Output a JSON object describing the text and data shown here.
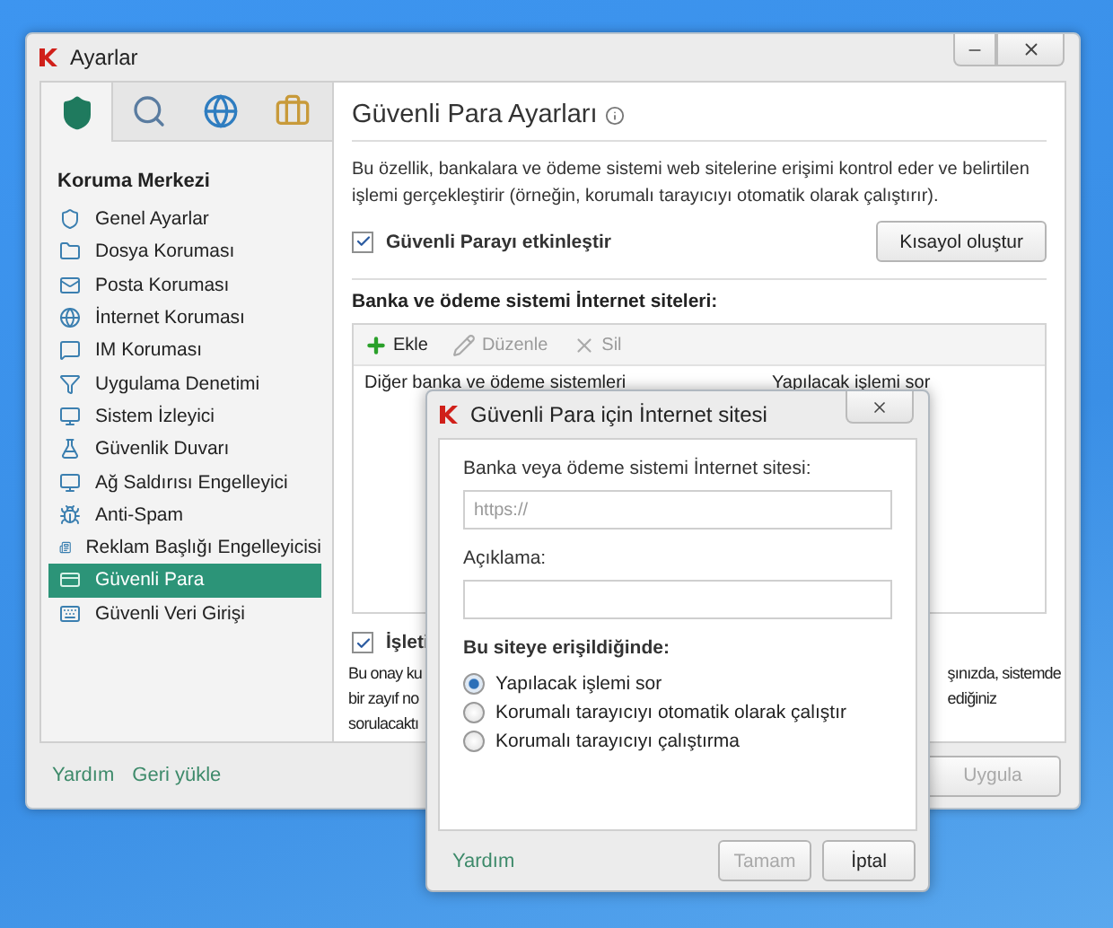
{
  "window": {
    "title": "Ayarlar"
  },
  "tabs": [
    {
      "selected": true
    },
    {
      "selected": false
    },
    {
      "selected": false
    },
    {
      "selected": false
    }
  ],
  "sidebar": {
    "heading": "Koruma Merkezi",
    "items": [
      {
        "label": "Genel Ayarlar",
        "selected": false
      },
      {
        "label": "Dosya Koruması",
        "selected": false
      },
      {
        "label": "Posta Koruması",
        "selected": false
      },
      {
        "label": "İnternet Koruması",
        "selected": false
      },
      {
        "label": "IM Koruması",
        "selected": false
      },
      {
        "label": "Uygulama Denetimi",
        "selected": false
      },
      {
        "label": "Sistem İzleyici",
        "selected": false
      },
      {
        "label": "Güvenlik Duvarı",
        "selected": false
      },
      {
        "label": "Ağ Saldırısı Engelleyici",
        "selected": false
      },
      {
        "label": "Anti-Spam",
        "selected": false
      },
      {
        "label": "Reklam Başlığı Engelleyicisi",
        "selected": false
      },
      {
        "label": "Güvenli Para",
        "selected": true
      },
      {
        "label": "Güvenli Veri Girişi",
        "selected": false
      }
    ]
  },
  "panel": {
    "title": "Güvenli Para Ayarları",
    "description": "Bu özellik, bankalara ve ödeme sistemi web sitelerine erişimi kontrol eder ve belirtilen işlemi gerçekleştirir (örneğin, korumalı tarayıcıyı otomatik olarak çalıştırır).",
    "enable": {
      "label": "Güvenli Parayı etkinleştir",
      "checked": true
    },
    "shortcut_button": "Kısayol oluştur",
    "sites_heading": "Banka ve ödeme sistemi İnternet siteleri:",
    "toolbar": [
      {
        "kind": "add",
        "label": "Ekle",
        "disabled": false
      },
      {
        "kind": "edit",
        "label": "Düzenle",
        "disabled": true
      },
      {
        "kind": "delete",
        "label": "Sil",
        "disabled": true
      }
    ],
    "rows": [
      {
        "site": "Diğer banka ve ödeme sistemleri",
        "action": "Yapılacak işlemi sor"
      }
    ],
    "os_check": {
      "label": "İşleti",
      "checked": true
    },
    "note_left": [
      "Bu onay ku",
      "bir zayıf no",
      "sorulacaktı"
    ],
    "note_right": [
      "şınızda, sistemde",
      "ediğiniz"
    ]
  },
  "footer": {
    "links": [
      "Yardım",
      "Geri yükle"
    ],
    "buttons": [
      {
        "label": "Uygula",
        "disabled": true
      }
    ]
  },
  "dialog": {
    "title": "Güvenli Para için İnternet sitesi",
    "url_label": "Banka veya ödeme sistemi İnternet sitesi:",
    "url_placeholder": "https://",
    "desc_label": "Açıklama:",
    "access_heading": "Bu siteye erişildiğinde:",
    "options": [
      {
        "label": "Yapılacak işlemi sor",
        "selected": true
      },
      {
        "label": "Korumalı tarayıcıyı otomatik olarak çalıştır",
        "selected": false
      },
      {
        "label": "Korumalı tarayıcıyı çalıştırma",
        "selected": false
      }
    ],
    "help": "Yardım",
    "buttons": [
      {
        "label": "Tamam",
        "disabled": true
      },
      {
        "label": "İptal",
        "disabled": false
      }
    ]
  }
}
